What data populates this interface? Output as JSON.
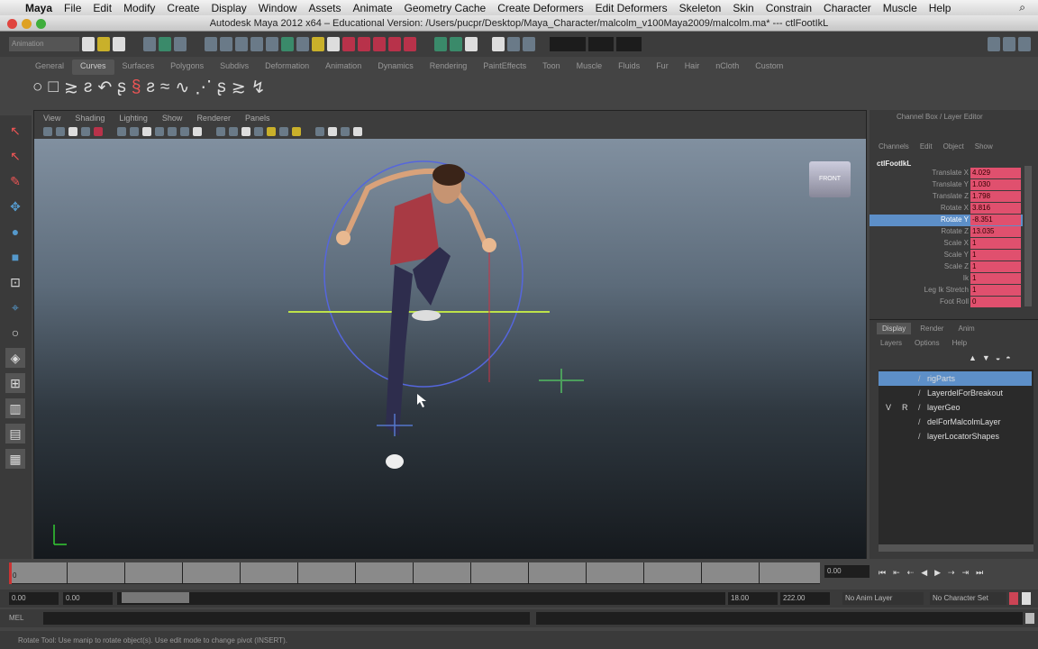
{
  "menubar": {
    "app": "Maya",
    "items": [
      "File",
      "Edit",
      "Modify",
      "Create",
      "Display",
      "Window",
      "Assets",
      "Animate",
      "Geometry Cache",
      "Create Deformers",
      "Edit Deformers",
      "Skeleton",
      "Skin",
      "Constrain",
      "Character",
      "Muscle",
      "Help"
    ]
  },
  "window": {
    "title": "Autodesk Maya 2012 x64 – Educational Version: /Users/pucpr/Desktop/Maya_Character/malcolm_v100Maya2009/malcolm.ma*  ---  ctlFootIkL"
  },
  "status_line": {
    "menuset": "Animation"
  },
  "shelf": {
    "tabs": [
      "General",
      "Curves",
      "Surfaces",
      "Polygons",
      "Subdivs",
      "Deformation",
      "Animation",
      "Dynamics",
      "Rendering",
      "PaintEffects",
      "Toon",
      "Muscle",
      "Fluids",
      "Fur",
      "Hair",
      "nCloth",
      "Custom"
    ],
    "active": "Curves"
  },
  "viewport": {
    "menu": [
      "View",
      "Shading",
      "Lighting",
      "Show",
      "Renderer",
      "Panels"
    ],
    "viewcube": "FRONT"
  },
  "channel_box": {
    "title": "Channel Box / Layer Editor",
    "menu": [
      "Channels",
      "Edit",
      "Object",
      "Show"
    ],
    "object": "ctlFootIkL",
    "channels": [
      {
        "label": "Translate X",
        "value": "4.029"
      },
      {
        "label": "Translate Y",
        "value": "1.030"
      },
      {
        "label": "Translate Z",
        "value": "1.798"
      },
      {
        "label": "Rotate X",
        "value": "3.816"
      },
      {
        "label": "Rotate Y",
        "value": "-8.351"
      },
      {
        "label": "Rotate Z",
        "value": "13.035"
      },
      {
        "label": "Scale X",
        "value": "1"
      },
      {
        "label": "Scale Y",
        "value": "1"
      },
      {
        "label": "Scale Z",
        "value": "1"
      },
      {
        "label": "Ik",
        "value": "1"
      },
      {
        "label": "Leg Ik Stretch",
        "value": "1"
      },
      {
        "label": "Foot Roll",
        "value": "0"
      }
    ],
    "selected_channel": "Rotate Y"
  },
  "layer_editor": {
    "tabs": [
      "Display",
      "Render",
      "Anim"
    ],
    "menu": [
      "Layers",
      "Options",
      "Help"
    ],
    "layers": [
      {
        "name": "rigParts",
        "v": "",
        "p": ""
      },
      {
        "name": "LayerdelForBreakout",
        "v": "",
        "p": ""
      },
      {
        "name": "layerGeo",
        "v": "V",
        "p": "R"
      },
      {
        "name": "delForMalcolmLayer",
        "v": "",
        "p": ""
      },
      {
        "name": "layerLocatorShapes",
        "v": "",
        "p": ""
      }
    ]
  },
  "timeline": {
    "current_frame": "0.00",
    "start": "0.00",
    "playback_start": "0.00",
    "playback_end": "18.00",
    "end": "222.00",
    "first_tick": "0",
    "anim_layer": "No Anim Layer",
    "character_set": "No Character Set"
  },
  "mel": {
    "label": "MEL"
  },
  "help_line": "Rotate Tool: Use manip to rotate object(s). Use edit mode to change pivot (INSERT)."
}
